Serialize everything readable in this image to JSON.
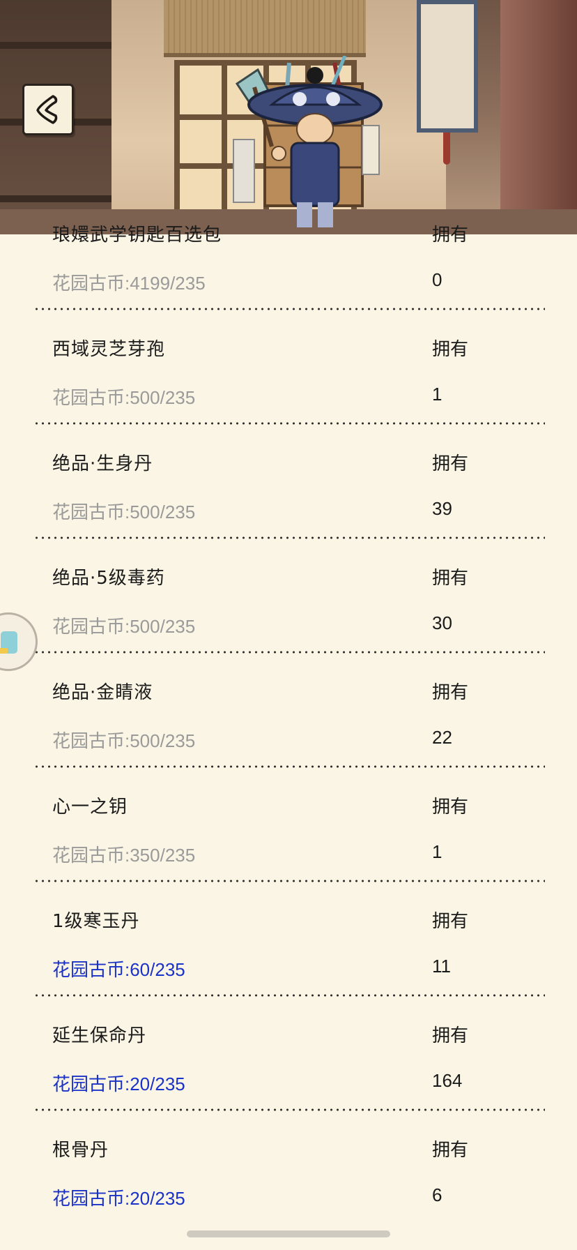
{
  "header": {
    "back_icon": "chevron-left-icon",
    "merchant_image": "wandering-merchant-with-backpack"
  },
  "own_label": "拥有",
  "items": [
    {
      "name": "琅嬛武学钥匙百选包",
      "price": "花园古币:4199/235",
      "count": "0",
      "affordable": false
    },
    {
      "name": "西域灵芝芽孢",
      "price": "花园古币:500/235",
      "count": "1",
      "affordable": false
    },
    {
      "name": "绝品·生身丹",
      "price": "花园古币:500/235",
      "count": "39",
      "affordable": false
    },
    {
      "name": "绝品·5级毒药",
      "price": "花园古币:500/235",
      "count": "30",
      "affordable": false
    },
    {
      "name": "绝品·金睛液",
      "price": "花园古币:500/235",
      "count": "22",
      "affordable": false
    },
    {
      "name": "心一之钥",
      "price": "花园古币:350/235",
      "count": "1",
      "affordable": false
    },
    {
      "name": "1级寒玉丹",
      "price": "花园古币:60/235",
      "count": "11",
      "affordable": true
    },
    {
      "name": "延生保命丹",
      "price": "花园古币:20/235",
      "count": "164",
      "affordable": true
    },
    {
      "name": "根骨丹",
      "price": "花园古币:20/235",
      "count": "6",
      "affordable": true
    }
  ],
  "colors": {
    "price_unaffordable": "#9a9a9a",
    "price_affordable": "#1a32c8",
    "background": "#faf5e4"
  }
}
